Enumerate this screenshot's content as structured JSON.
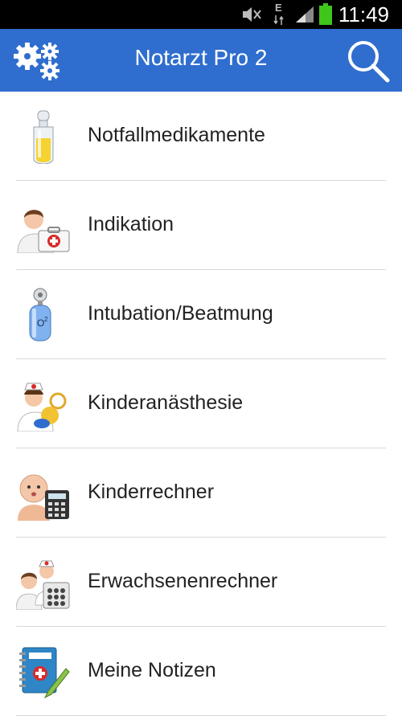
{
  "status": {
    "time": "11:49",
    "network": "E"
  },
  "app": {
    "title": "Notarzt Pro 2"
  },
  "menu": [
    {
      "label": "Notfallmedikamente",
      "icon": "ampoule-icon"
    },
    {
      "label": "Indikation",
      "icon": "doctor-firstaid-icon"
    },
    {
      "label": "Intubation/Beatmung",
      "icon": "oxygen-tank-icon"
    },
    {
      "label": "Kinderanästhesie",
      "icon": "nurse-baby-icon"
    },
    {
      "label": "Kinderrechner",
      "icon": "baby-calculator-icon"
    },
    {
      "label": "Erwachsenenrechner",
      "icon": "adults-calculator-icon"
    },
    {
      "label": "Meine Notizen",
      "icon": "medical-notebook-icon"
    }
  ],
  "colors": {
    "appbar": "#2f6ecf",
    "divider": "#d8d8d8"
  }
}
